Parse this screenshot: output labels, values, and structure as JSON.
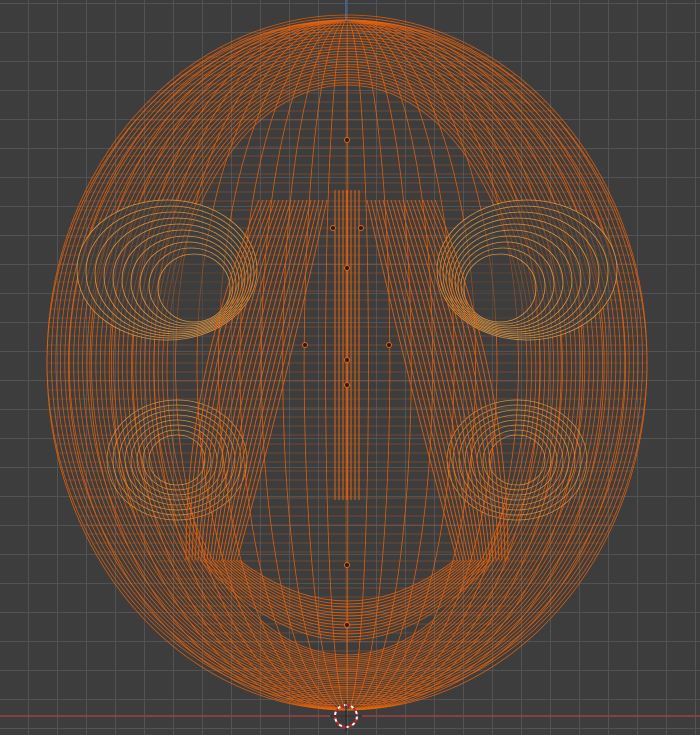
{
  "viewport": {
    "mode": "wireframe",
    "object": "skull",
    "colors": {
      "background": "#3d3d3d",
      "grid": "#555555",
      "wire_primary": "#e8620c",
      "wire_secondary": "#f0a040",
      "x_axis": "#b04040",
      "z_axis": "#4060a0"
    }
  }
}
